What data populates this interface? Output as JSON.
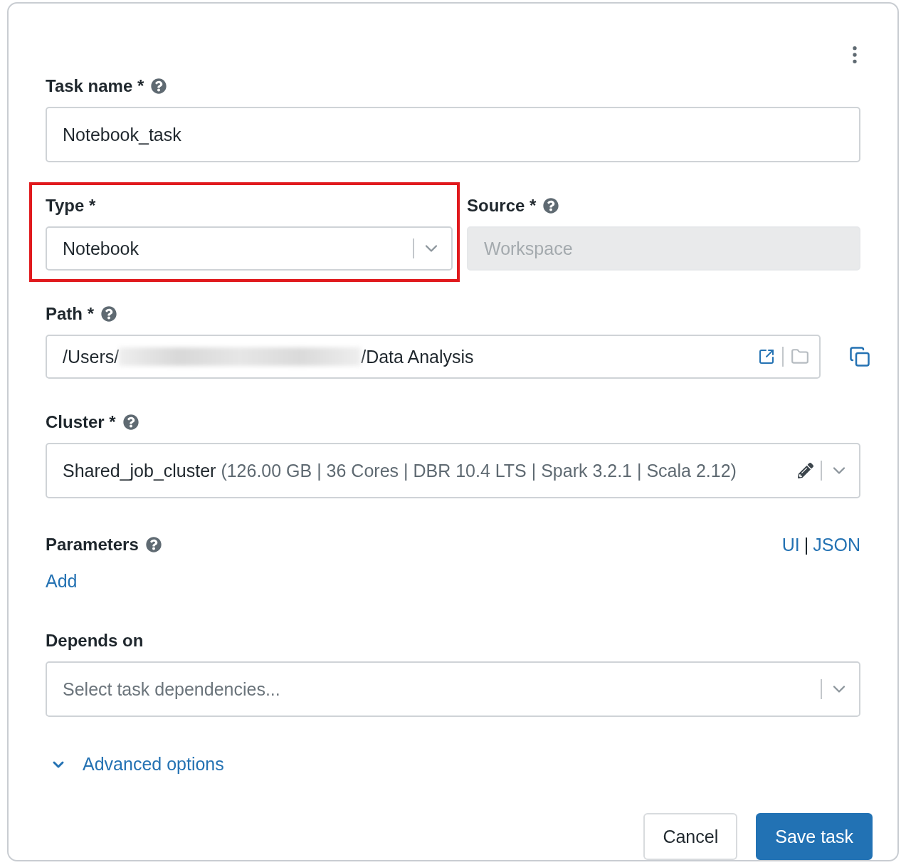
{
  "task_name": {
    "label": "Task name *",
    "value": "Notebook_task"
  },
  "type": {
    "label": "Type *",
    "value": "Notebook",
    "highlighted": true
  },
  "source": {
    "label": "Source *",
    "value": "Workspace",
    "disabled": true
  },
  "path": {
    "label": "Path *",
    "prefix": "/Users/",
    "suffix": "/Data Analysis"
  },
  "cluster": {
    "label": "Cluster *",
    "name": "Shared_job_cluster",
    "details": "(126.00 GB | 36 Cores | DBR 10.4 LTS | Spark 3.2.1 | Scala 2.12)"
  },
  "parameters": {
    "label": "Parameters",
    "add_link": "Add",
    "modes": [
      "UI",
      "JSON"
    ],
    "separator": "|"
  },
  "depends_on": {
    "label": "Depends on",
    "placeholder": "Select task dependencies..."
  },
  "advanced": {
    "label": "Advanced options",
    "expanded": false
  },
  "buttons": [
    {
      "label": "Cancel",
      "kind": "secondary"
    },
    {
      "label": "Save task",
      "kind": "primary"
    }
  ]
}
